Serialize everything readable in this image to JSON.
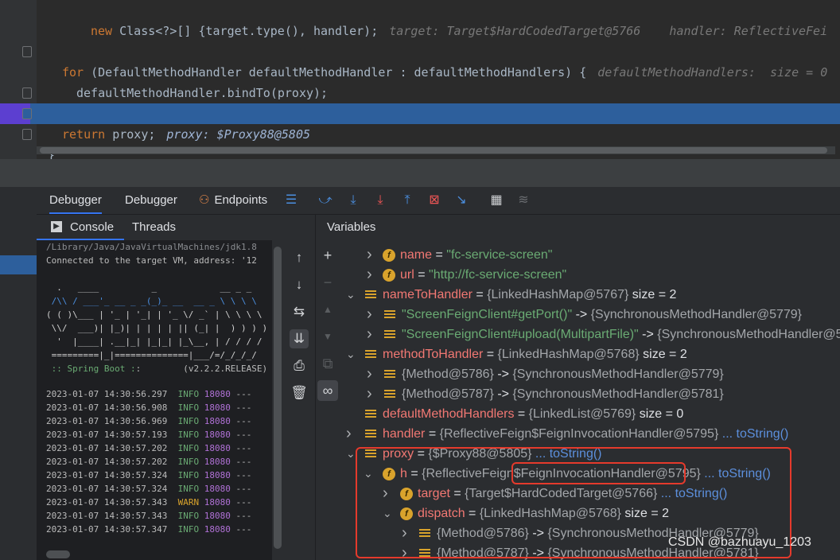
{
  "editor": {
    "lines": [
      {
        "code_kw": "new",
        "code": " Class<?>[] {target.type(), handler);",
        "hint": "target: Target$HardCodedTarget@5766    handler: ReflectiveFei"
      },
      {
        "code_kw": "",
        "code": "",
        "hint": ""
      },
      {
        "code_kw": "for",
        "code": " (DefaultMethodHandler defaultMethodHandler : defaultMethodHandlers) {",
        "hint": "defaultMethodHandlers:  size = 0"
      },
      {
        "code_kw": "",
        "code": "defaultMethodHandler.bindTo(proxy);",
        "hint": ""
      },
      {
        "code_kw": "",
        "code": "}",
        "hint": ""
      },
      {
        "code_kw": "return",
        "code": " proxy;",
        "hint": "proxy: $Proxy88@5805"
      },
      {
        "code_kw": "",
        "code": "}",
        "hint": ""
      }
    ]
  },
  "debugger": {
    "tabs": [
      "Debugger",
      "Debugger",
      "Endpoints"
    ],
    "subtabs": {
      "console": "Console",
      "threads": "Threads"
    },
    "variables_title": "Variables"
  },
  "console": {
    "lines": [
      "/Library/Java/JavaVirtualMachines/jdk1.8",
      "Connected to the target VM, address: '12",
      "",
      "  .   ____          _            __ _ _",
      " /\\\\ / ___'_ __ _ _(_)_ __  __ _ \\ \\ \\ \\",
      "( ( )\\___ | '_ | '_| | '_ \\/ _` | \\ \\ \\ \\",
      " \\\\/  ___)| |_)| | | | | || (_| |  ) ) ) )",
      "  '  |____| .__|_| |_|_| |_\\__, | / / / /",
      " =========|_|==============|___/=/_/_/_/",
      " :: Spring Boot ::        (v2.2.2.RELEASE)",
      "",
      "2023-01-07 14:30:56.297  INFO 18080 ---",
      "2023-01-07 14:30:56.908  INFO 18080 ---",
      "2023-01-07 14:30:56.969  INFO 18080 ---",
      "2023-01-07 14:30:57.193  INFO 18080 ---",
      "2023-01-07 14:30:57.202  INFO 18080 ---",
      "2023-01-07 14:30:57.202  INFO 18080 ---",
      "2023-01-07 14:30:57.324  INFO 18080 ---",
      "2023-01-07 14:30:57.324  INFO 18080 ---",
      "2023-01-07 14:30:57.343  WARN 18080 ---",
      "2023-01-07 14:30:57.343  INFO 18080 ---",
      "2023-01-07 14:30:57.347  INFO 18080 ---"
    ]
  },
  "variables": {
    "rows": [
      {
        "name": "name",
        "eq": " = ",
        "val": "\"fc-service-screen\"",
        "kind": "str"
      },
      {
        "name": "url",
        "eq": " = ",
        "val": "\"http://fc-service-screen\"",
        "kind": "str"
      },
      {
        "name": "nameToHandler",
        "eq": " = ",
        "val": "{LinkedHashMap@5767}",
        "extra": "size = 2"
      },
      {
        "name": "\"ScreenFeignClient#getPort()\"",
        "eq": " -> ",
        "val": "{SynchronousMethodHandler@5779}",
        "kind": "keystr"
      },
      {
        "name": "\"ScreenFeignClient#upload(MultipartFile)\"",
        "eq": " -> ",
        "val": "{SynchronousMethodHandler@5",
        "kind": "keystr"
      },
      {
        "name": "methodToHandler",
        "eq": " = ",
        "val": "{LinkedHashMap@5768}",
        "extra": "size = 2"
      },
      {
        "name": "{Method@5786}",
        "eq": " -> ",
        "val": "{SynchronousMethodHandler@5779}",
        "kind": "key"
      },
      {
        "name": "{Method@5787}",
        "eq": " -> ",
        "val": "{SynchronousMethodHandler@5781}",
        "kind": "key"
      },
      {
        "name": "defaultMethodHandlers",
        "eq": " = ",
        "val": "{LinkedList@5769}",
        "extra": "size = 0"
      },
      {
        "name": "handler",
        "eq": " = ",
        "val": "{ReflectiveFeign$FeignInvocationHandler@5795}",
        "link": "... toString()"
      },
      {
        "name": "proxy",
        "eq": " = ",
        "val": "{$Proxy88@5805}",
        "link": "... toString()"
      },
      {
        "name": "h",
        "eq": " = ",
        "val": "{ReflectiveFeign$FeignInvocationHandler@5795}",
        "link": "... toString()"
      },
      {
        "name": "target",
        "eq": " = ",
        "val": "{Target$HardCodedTarget@5766}",
        "link": "... toString()"
      },
      {
        "name": "dispatch",
        "eq": " = ",
        "val": "{LinkedHashMap@5768}",
        "extra": "size = 2"
      },
      {
        "name": "{Method@5786}",
        "eq": " -> ",
        "val": "{SynchronousMethodHandler@5779}",
        "kind": "key"
      },
      {
        "name": "{Method@5787}",
        "eq": " -> ",
        "val": "{SynchronousMethodHandler@5781}",
        "kind": "key"
      }
    ]
  },
  "watermark": "CSDN @bazhuayu_1203",
  "colors": {
    "highlight": "#2d5f9c",
    "breakpoint": "#5c3fd0",
    "annotation": "#e53a2c"
  }
}
